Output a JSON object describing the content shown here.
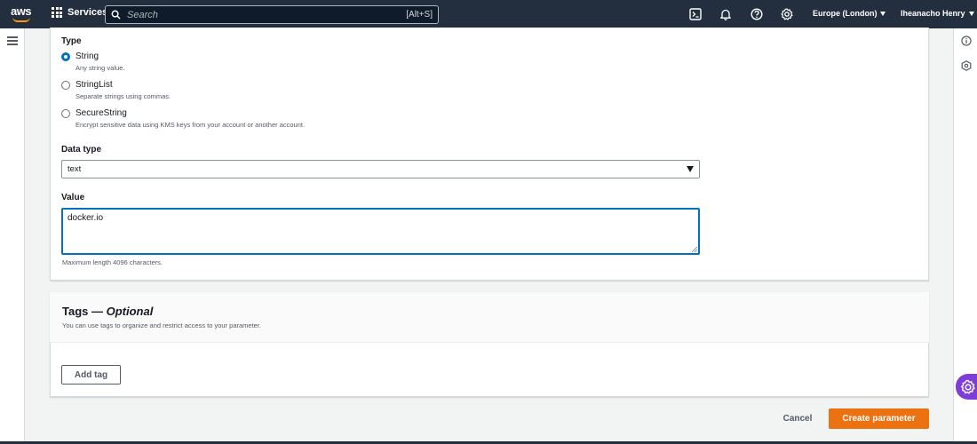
{
  "topnav": {
    "logo_text": "aws",
    "services_label": "Services",
    "search_placeholder": "Search",
    "search_shortcut": "[Alt+S]",
    "region_label": "Europe (London)",
    "user_label": "Iheanacho Henry",
    "icons": [
      "cloudshell-icon",
      "notifications-bell-icon",
      "help-icon",
      "settings-gear-icon"
    ]
  },
  "form": {
    "type_label": "Type",
    "type_options": [
      {
        "label": "String",
        "description": "Any string value.",
        "checked": true
      },
      {
        "label": "StringList",
        "description": "Separate strings using commas.",
        "checked": false
      },
      {
        "label": "SecureString",
        "description": "Encrypt sensitive data using KMS keys from your account or another account.",
        "checked": false
      }
    ],
    "data_type_label": "Data type",
    "data_type_value": "text",
    "value_label": "Value",
    "value_text": "docker.io",
    "value_hint": "Maximum length 4096 characters."
  },
  "tags": {
    "title_main": "Tags — ",
    "title_optional": "Optional",
    "description": "You can use tags to organize and restrict access to your parameter.",
    "add_tag_label": "Add tag"
  },
  "actions": {
    "cancel_label": "Cancel",
    "create_label": "Create parameter"
  },
  "colors": {
    "nav_bg": "#232f3e",
    "primary_button": "#ec7211",
    "focus_blue": "#0073bb",
    "floating_widget": "#7d3ddb"
  }
}
